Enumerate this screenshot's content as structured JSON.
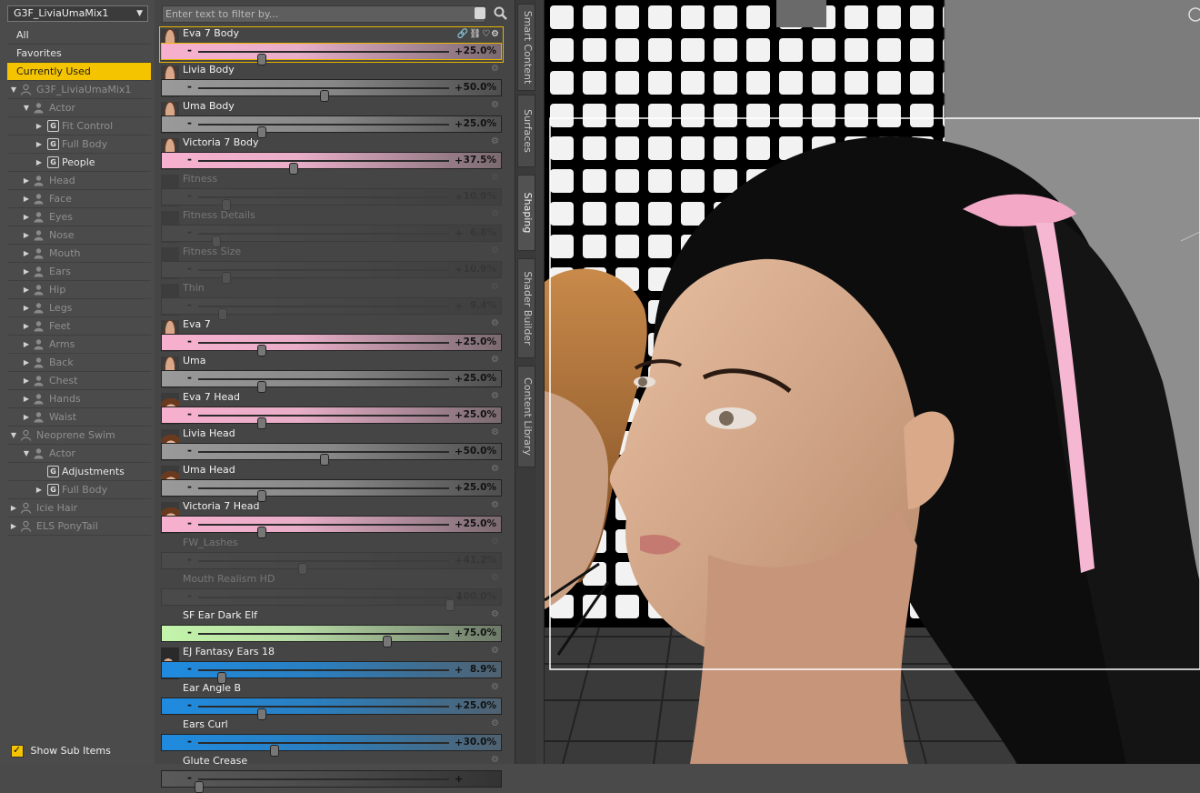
{
  "figure_selector": {
    "value": "G3F_LiviaUmaMix1"
  },
  "tree": {
    "items": [
      {
        "label": "All",
        "indent": 0,
        "tri": "",
        "icon": "none",
        "state": "normal"
      },
      {
        "label": "Favorites",
        "indent": 0,
        "tri": "",
        "icon": "none",
        "state": "normal"
      },
      {
        "label": "Currently Used",
        "indent": 0,
        "tri": "",
        "icon": "none",
        "state": "selected"
      },
      {
        "label": "G3F_LiviaUmaMix1",
        "indent": 0,
        "tri": "▼",
        "icon": "figure",
        "state": "dim"
      },
      {
        "label": "Actor",
        "indent": 1,
        "tri": "▼",
        "icon": "person",
        "state": "dim"
      },
      {
        "label": "Fit Control",
        "indent": 2,
        "tri": "▶",
        "icon": "group",
        "state": "dim"
      },
      {
        "label": "Full Body",
        "indent": 2,
        "tri": "▶",
        "icon": "group",
        "state": "dim"
      },
      {
        "label": "People",
        "indent": 2,
        "tri": "▶",
        "icon": "group",
        "state": "normal"
      },
      {
        "label": "Head",
        "indent": 1,
        "tri": "▶",
        "icon": "person",
        "state": "dim"
      },
      {
        "label": "Face",
        "indent": 1,
        "tri": "▶",
        "icon": "person",
        "state": "dim"
      },
      {
        "label": "Eyes",
        "indent": 1,
        "tri": "▶",
        "icon": "person",
        "state": "dim"
      },
      {
        "label": "Nose",
        "indent": 1,
        "tri": "▶",
        "icon": "person",
        "state": "dim"
      },
      {
        "label": "Mouth",
        "indent": 1,
        "tri": "▶",
        "icon": "person",
        "state": "dim"
      },
      {
        "label": "Ears",
        "indent": 1,
        "tri": "▶",
        "icon": "person",
        "state": "dim"
      },
      {
        "label": "Hip",
        "indent": 1,
        "tri": "▶",
        "icon": "person",
        "state": "dim"
      },
      {
        "label": "Legs",
        "indent": 1,
        "tri": "▶",
        "icon": "person",
        "state": "dim"
      },
      {
        "label": "Feet",
        "indent": 1,
        "tri": "▶",
        "icon": "person",
        "state": "dim"
      },
      {
        "label": "Arms",
        "indent": 1,
        "tri": "▶",
        "icon": "person",
        "state": "dim"
      },
      {
        "label": "Back",
        "indent": 1,
        "tri": "▶",
        "icon": "person",
        "state": "dim"
      },
      {
        "label": "Chest",
        "indent": 1,
        "tri": "▶",
        "icon": "person",
        "state": "dim"
      },
      {
        "label": "Hands",
        "indent": 1,
        "tri": "▶",
        "icon": "person",
        "state": "dim"
      },
      {
        "label": "Waist",
        "indent": 1,
        "tri": "▶",
        "icon": "person",
        "state": "dim"
      },
      {
        "label": "Neoprene Swim",
        "indent": 0,
        "tri": "▼",
        "icon": "figure",
        "state": "dim"
      },
      {
        "label": "Actor",
        "indent": 1,
        "tri": "▼",
        "icon": "person",
        "state": "dim"
      },
      {
        "label": "Adjustments",
        "indent": 2,
        "tri": "",
        "icon": "group",
        "state": "normal"
      },
      {
        "label": "Full Body",
        "indent": 2,
        "tri": "▶",
        "icon": "group",
        "state": "dim"
      },
      {
        "label": "Icie Hair",
        "indent": 0,
        "tri": "▶",
        "icon": "figure",
        "state": "dim"
      },
      {
        "label": "ELS PonyTail",
        "indent": 0,
        "tri": "▶",
        "icon": "figure",
        "state": "dim"
      }
    ],
    "show_sub_items": "Show Sub Items"
  },
  "filter": {
    "placeholder": "Enter text to filter by..."
  },
  "sliders": [
    {
      "name": "Eva 7 Body",
      "value": 25.0,
      "display": "25.0%",
      "bar": "pink",
      "thumb": "body",
      "selected": true,
      "active": true
    },
    {
      "name": "Livia Body",
      "value": 50.0,
      "display": "50.0%",
      "bar": "gray",
      "thumb": "body",
      "selected": false,
      "active": true
    },
    {
      "name": "Uma Body",
      "value": 25.0,
      "display": "25.0%",
      "bar": "gray",
      "thumb": "body",
      "selected": false,
      "active": true
    },
    {
      "name": "Victoria 7 Body",
      "value": 37.5,
      "display": "37.5%",
      "bar": "pink",
      "thumb": "body",
      "selected": false,
      "active": true
    },
    {
      "name": "Fitness",
      "value": 10.9,
      "display": "10.9%",
      "bar": "dark",
      "thumb": "dark",
      "selected": false,
      "active": false
    },
    {
      "name": "Fitness Details",
      "value": 6.8,
      "display": "6.8%",
      "bar": "dark",
      "thumb": "dark",
      "selected": false,
      "active": false
    },
    {
      "name": "Fitness Size",
      "value": 10.9,
      "display": "10.9%",
      "bar": "dark",
      "thumb": "dark",
      "selected": false,
      "active": false
    },
    {
      "name": "Thin",
      "value": 9.4,
      "display": "9.4%",
      "bar": "dark",
      "thumb": "dark",
      "selected": false,
      "active": false
    },
    {
      "name": "Eva 7",
      "value": 25.0,
      "display": "25.0%",
      "bar": "pink",
      "thumb": "body",
      "selected": false,
      "active": true
    },
    {
      "name": "Uma",
      "value": 25.0,
      "display": "25.0%",
      "bar": "gray",
      "thumb": "body",
      "selected": false,
      "active": true
    },
    {
      "name": "Eva 7 Head",
      "value": 25.0,
      "display": "25.0%",
      "bar": "pink",
      "thumb": "head",
      "selected": false,
      "active": true
    },
    {
      "name": "Livia Head",
      "value": 50.0,
      "display": "50.0%",
      "bar": "gray",
      "thumb": "head",
      "selected": false,
      "active": true
    },
    {
      "name": "Uma Head",
      "value": 25.0,
      "display": "25.0%",
      "bar": "gray",
      "thumb": "head",
      "selected": false,
      "active": true
    },
    {
      "name": "Victoria 7 Head",
      "value": 25.0,
      "display": "25.0%",
      "bar": "pink",
      "thumb": "head",
      "selected": false,
      "active": true
    },
    {
      "name": "FW_Lashes",
      "value": 41.2,
      "display": "41.2%",
      "bar": "dark",
      "thumb": "none",
      "selected": false,
      "active": false
    },
    {
      "name": "Mouth Realism HD",
      "value": 100.0,
      "display": "100.0%",
      "bar": "dark",
      "thumb": "none",
      "selected": false,
      "active": false
    },
    {
      "name": "SF Ear Dark Elf",
      "value": 75.0,
      "display": "75.0%",
      "bar": "green",
      "thumb": "none",
      "selected": false,
      "active": true
    },
    {
      "name": "EJ Fantasy Ears 18",
      "value": 8.9,
      "display": "8.9%",
      "bar": "blue",
      "thumb": "ear",
      "selected": false,
      "active": true
    },
    {
      "name": "Ear Angle B",
      "value": 25.0,
      "display": "25.0%",
      "bar": "blue",
      "thumb": "none",
      "selected": false,
      "active": true
    },
    {
      "name": "Ears Curl",
      "value": 30.0,
      "display": "30.0%",
      "bar": "blue",
      "thumb": "none",
      "selected": false,
      "active": true
    },
    {
      "name": "Glute Crease",
      "value": 0,
      "display": "",
      "bar": "dark",
      "thumb": "none",
      "selected": false,
      "active": true
    }
  ],
  "side_tabs": [
    "Smart Content",
    "Surfaces",
    "Shaping",
    "Shader Builder",
    "Content Library"
  ],
  "active_side_tab": "Shaping",
  "colors": {
    "accent": "#f5c400",
    "pink_bar": "#f4a6c9",
    "blue_bar": "#1e8ad6",
    "green_bar": "#b9f0a0"
  }
}
